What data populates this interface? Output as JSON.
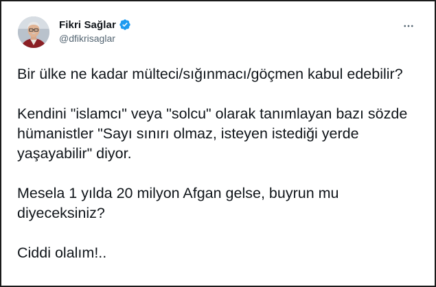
{
  "tweet": {
    "author": {
      "display_name": "Fikri Sağlar",
      "handle": "@dfikrisaglar",
      "verified_icon": "verified-badge-icon",
      "verified_color": "#1d9bf0"
    },
    "menu_icon": "more-horizontal-icon",
    "paragraphs": [
      "Bir ülke ne kadar mülteci/sığınmacı/göçmen kabul edebilir?",
      "Kendini \"islamcı\" veya \"solcu\" olarak tanımlayan bazı sözde hümanistler \"Sayı sınırı olmaz, isteyen istediği yerde yaşayabilir\" diyor.",
      "Mesela 1 yılda 20 milyon Afgan gelse, buyrun mu diyeceksiniz?",
      "Ciddi olalım!.."
    ]
  },
  "colors": {
    "text": "#0f1419",
    "secondary_text": "#536471",
    "border": "#1a1a1a"
  }
}
